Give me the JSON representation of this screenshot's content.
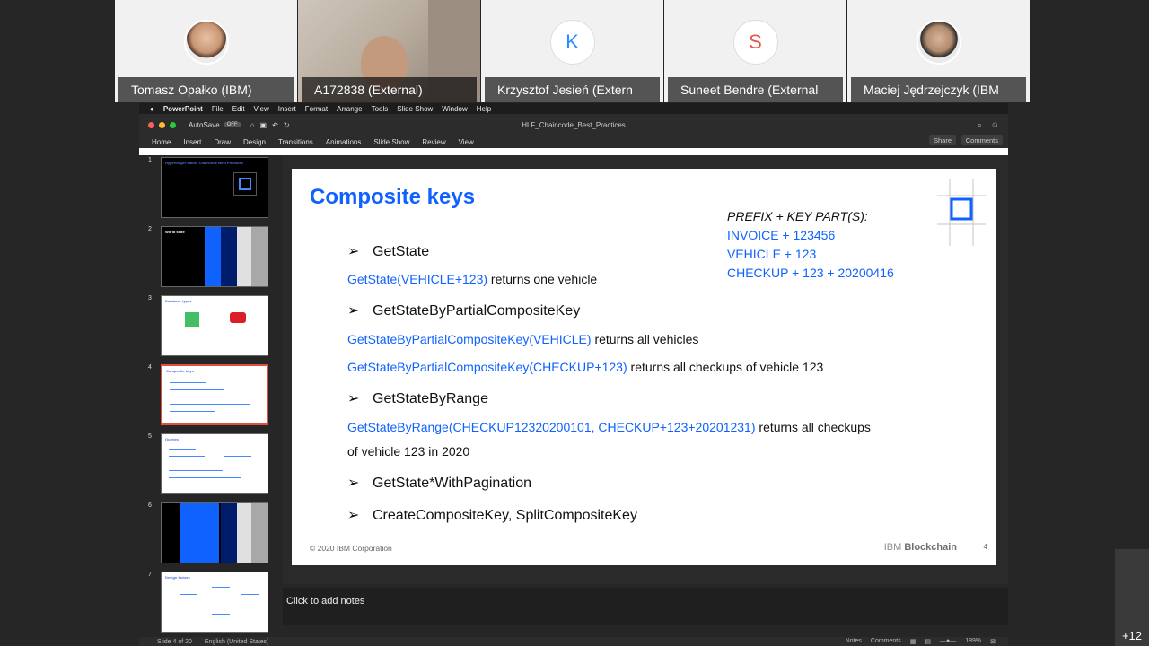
{
  "participants": [
    {
      "name": "Tomasz Opałko (IBM)",
      "kind": "photo"
    },
    {
      "name": "A172838 (External)",
      "kind": "video"
    },
    {
      "name": "Krzysztof Jesień (Extern",
      "kind": "letter",
      "letter": "K",
      "color": "#2d8cff"
    },
    {
      "name": "Suneet Bendre (External",
      "kind": "letter",
      "letter": "S",
      "color": "#e8564a"
    },
    {
      "name": "Maciej Jędrzejczyk (IBM",
      "kind": "photo"
    }
  ],
  "mac_menu": {
    "apple": "",
    "app": "PowerPoint",
    "items": [
      "File",
      "Edit",
      "View",
      "Insert",
      "Format",
      "Arrange",
      "Tools",
      "Slide Show",
      "Window",
      "Help"
    ]
  },
  "titlebar": {
    "autosave": "AutoSave",
    "toggle": "OFF",
    "doc_title": "HLF_Chaincode_Best_Practices"
  },
  "ribbon": {
    "tabs": [
      "Home",
      "Insert",
      "Draw",
      "Design",
      "Transitions",
      "Animations",
      "Slide Show",
      "Review",
      "View"
    ],
    "share": "Share",
    "comments": "Comments"
  },
  "thumbnails": [
    {
      "num": "1",
      "title": "Hyperledger Fabric Chaincode Best Practices"
    },
    {
      "num": "2",
      "title": "World state"
    },
    {
      "num": "3",
      "title": "Database types"
    },
    {
      "num": "4",
      "title": "Composite keys"
    },
    {
      "num": "5",
      "title": "Queries"
    },
    {
      "num": "6",
      "title": ""
    },
    {
      "num": "7",
      "title": "Design factors"
    }
  ],
  "slide": {
    "title": "Composite keys",
    "prefix_header": "PREFIX + KEY PART(S):",
    "prefix_examples": [
      "INVOICE + 123456",
      "VEHICLE + 123",
      "CHECKUP + 123 + 20200416"
    ],
    "bullet_arrow": "➢",
    "b1": "GetState",
    "l1_code": "GetState(VEHICLE+123)",
    "l1_text": " returns one vehicle",
    "b2": "GetStateByPartialCompositeKey",
    "l2_code": "GetStateByPartialCompositeKey(VEHICLE)",
    "l2_text": " returns all vehicles",
    "l3_code": "GetStateByPartialCompositeKey(CHECKUP+123)",
    "l3_text": " returns all checkups of vehicle 123",
    "b3": "GetStateByRange",
    "l4_code": "GetStateByRange(CHECKUP12320200101, CHECKUP+123+20201231)",
    "l4_text": " returns all checkups",
    "l4_cont": "of vehicle 123 in 2020",
    "b4": "GetState*WithPagination",
    "b5": "CreateCompositeKey, SplitCompositeKey",
    "footer": "© 2020 IBM Corporation",
    "brand_ibm": "IBM",
    "brand_product": "Blockchain",
    "page": "4"
  },
  "notes_placeholder": "Click to add notes",
  "status": {
    "slide": "Slide 4 of 20",
    "language": "English (United States)",
    "notes": "Notes",
    "comments": "Comments",
    "zoom": "189%"
  },
  "overflow_count": "+12"
}
